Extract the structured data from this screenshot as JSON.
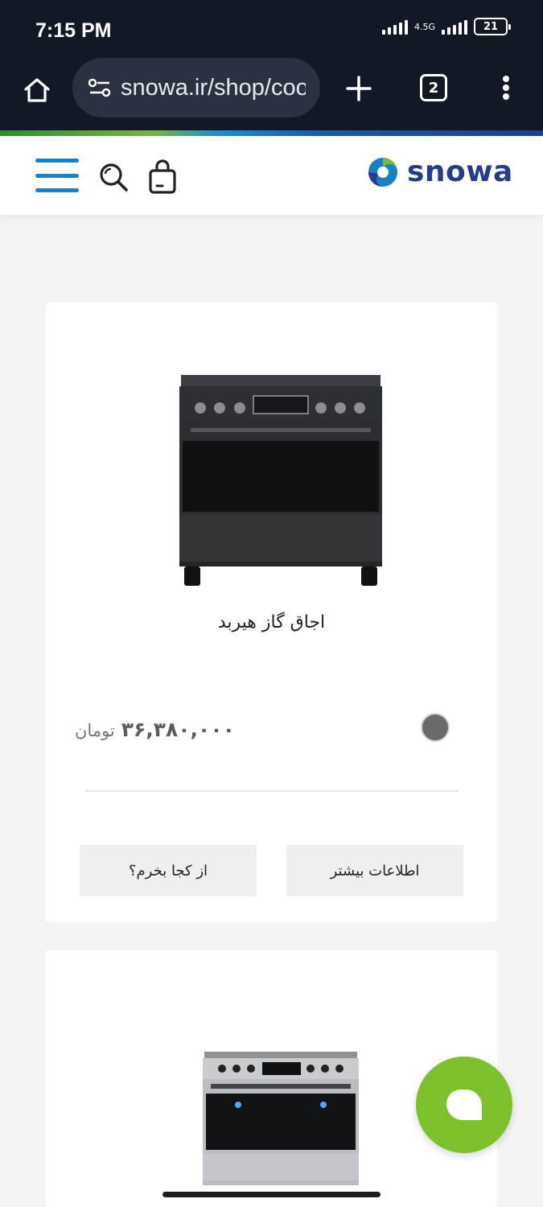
{
  "status_bar": {
    "time": "7:15 PM",
    "network": "4.5G",
    "battery": "21"
  },
  "browser": {
    "url": "snowa.ir/shop/cooking",
    "tab_count": "2"
  },
  "header": {
    "logo_text": "snowa"
  },
  "products": [
    {
      "title": "اجاق گاز هیربد",
      "price": "۳۶,۳۸۰,۰۰۰",
      "currency": "تومان",
      "color_swatch": "#6a6a6a",
      "buttons": {
        "where_to_buy": "از کجا بخرم؟",
        "more_info": "اطلاعات بیشتر"
      }
    }
  ],
  "colors": {
    "brand_blue": "#263b8c",
    "menu_blue": "#1d7fc3",
    "chat_green": "#7cc02c"
  },
  "icons": [
    "home-icon",
    "site-settings-icon",
    "plus-icon",
    "more-vert-icon",
    "menu-icon",
    "search-icon",
    "shopping-bag-icon",
    "chat-icon"
  ]
}
